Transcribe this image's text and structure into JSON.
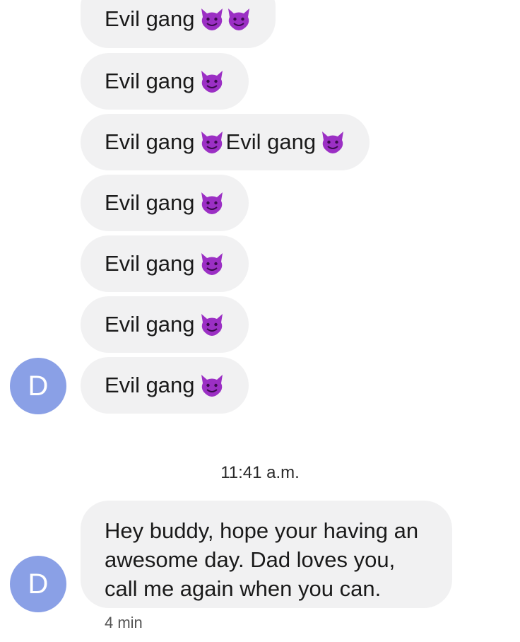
{
  "messages": [
    {
      "text": "Evil gang",
      "emojis": [
        "smiling-imp",
        "smiling-imp"
      ]
    },
    {
      "text": "Evil gang",
      "emojis": [
        "smiling-imp"
      ]
    },
    {
      "text": "Evil gang",
      "emojis": [
        "smiling-imp"
      ],
      "text2": "Evil gang",
      "emojis2": [
        "smiling-imp"
      ]
    },
    {
      "text": "Evil gang",
      "emojis": [
        "smiling-imp"
      ]
    },
    {
      "text": "Evil gang",
      "emojis": [
        "smiling-imp"
      ]
    },
    {
      "text": "Evil gang",
      "emojis": [
        "smiling-imp"
      ]
    },
    {
      "text": "Evil gang",
      "emojis": [
        "smiling-imp"
      ]
    }
  ],
  "avatar_initial": "D",
  "timestamp": "11:41 a.m.",
  "dad_message": {
    "lines": [
      "Hey buddy, hope your having an",
      "awesome day. Dad loves you,",
      "call me again when you can."
    ]
  },
  "dad_avatar_initial": "D",
  "sent_ago": "4 min",
  "colors": {
    "bubble": "#f1f1f2",
    "avatar": "#8aa0e6",
    "emoji_purple": "#9b2fc4"
  }
}
